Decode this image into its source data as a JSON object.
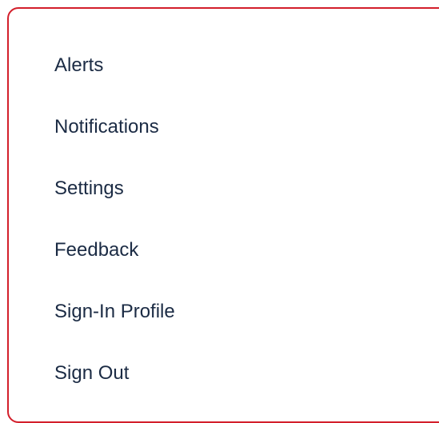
{
  "menu": {
    "border_color": "#d31f2b",
    "text_color": "#1b2b44",
    "items": [
      {
        "label": "Alerts"
      },
      {
        "label": "Notifications"
      },
      {
        "label": "Settings"
      },
      {
        "label": "Feedback"
      },
      {
        "label": "Sign-In Profile"
      },
      {
        "label": "Sign Out"
      }
    ]
  }
}
